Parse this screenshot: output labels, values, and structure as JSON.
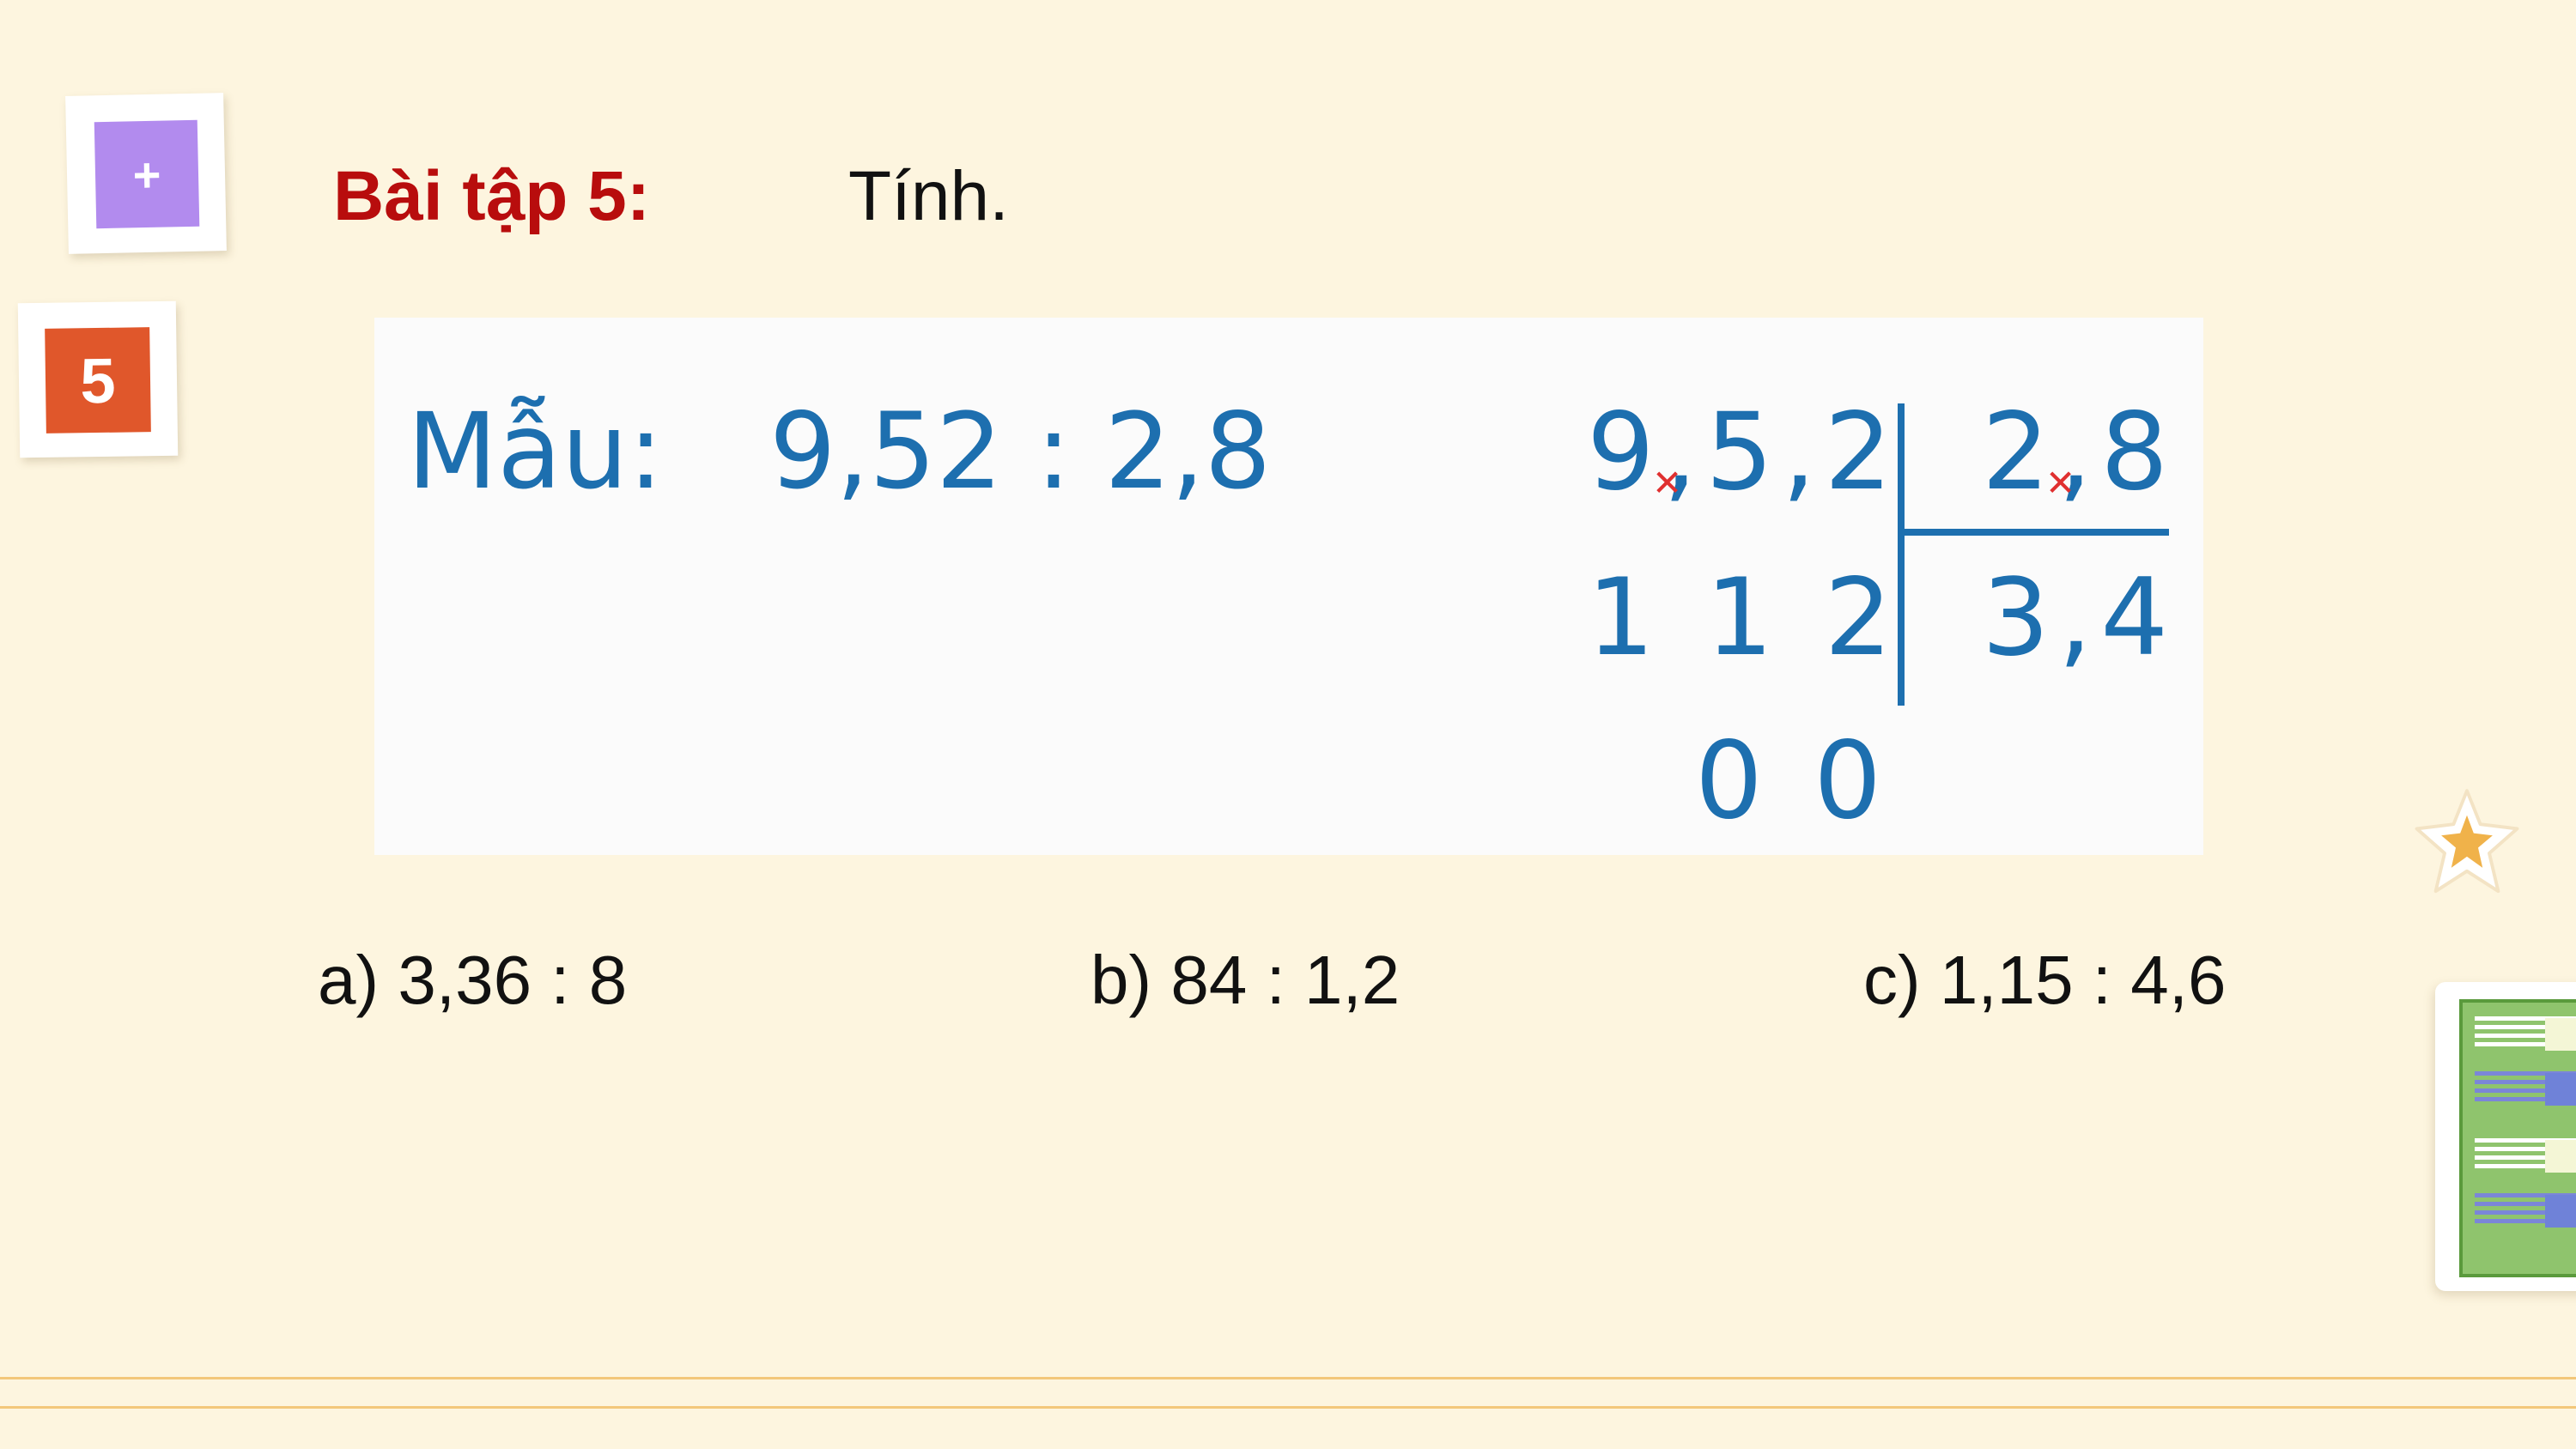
{
  "slide": {
    "plus_badge": "+",
    "exercise_number": "5",
    "title": "Bài tập 5:",
    "instruction": "Tính."
  },
  "example": {
    "label": "Mẫu:",
    "expression": "9,52 : 2,8",
    "long_division": {
      "dividend": "9,5,2",
      "divisor": "2,8",
      "subtotal": "1 1 2",
      "quotient": "3,4",
      "remainder": "0 0"
    }
  },
  "problems": [
    {
      "label": "a) 3,36 : 8"
    },
    {
      "label": "b) 84 : 1,2"
    },
    {
      "label": "c) 1,15 : 4,6"
    }
  ],
  "colors": {
    "background": "#fdf5df",
    "title_red": "#b80d0d",
    "example_blue": "#1d6faf",
    "accent_purple": "#b28bee",
    "accent_orange": "#e0572b",
    "line_gold": "#f3c77a"
  },
  "icons": [
    "plus-icon",
    "star-icon",
    "worksheet-icon"
  ]
}
